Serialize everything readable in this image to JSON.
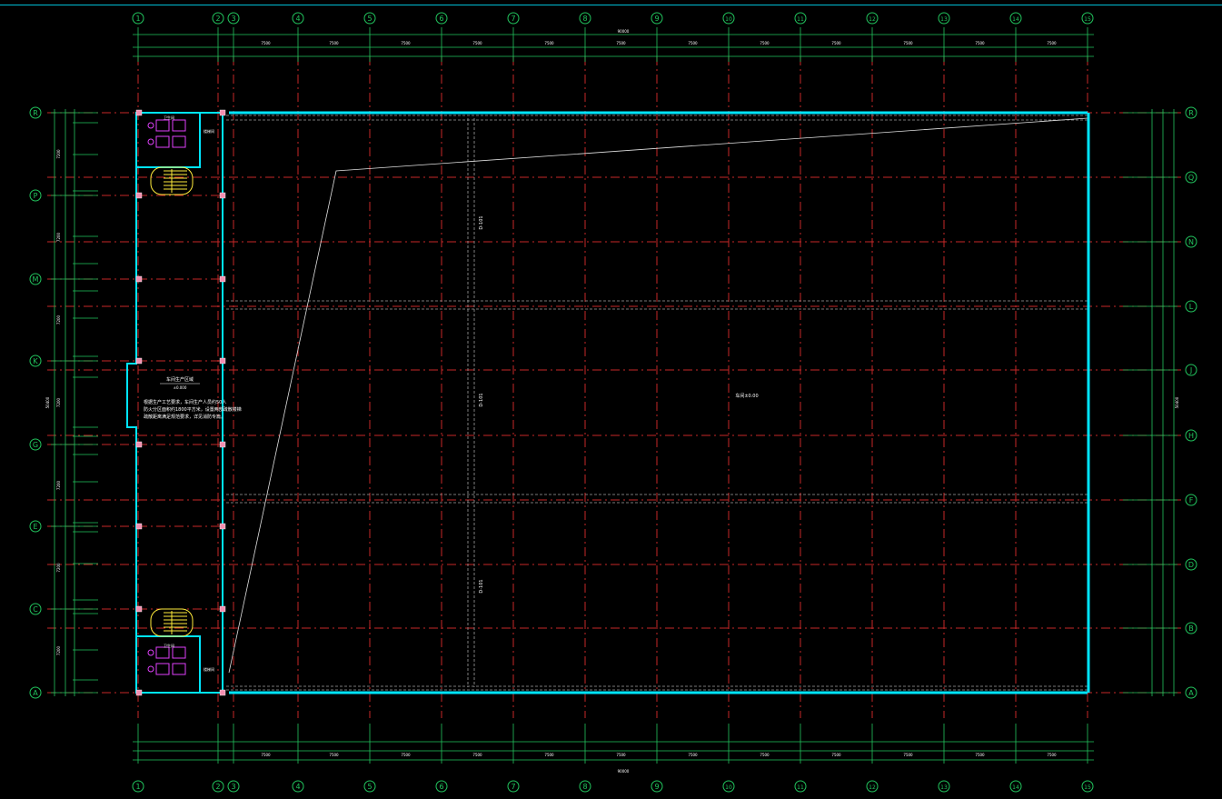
{
  "drawing": {
    "colors": {
      "background": "#000000",
      "grid_lines": "#c62828",
      "dimensions": "#22c55e",
      "axis_bubbles": "#22c55e",
      "walls": "#00e5ff",
      "stairs": "#ffeb3b",
      "fixtures": "#e040fb",
      "columns": "#f48fb1",
      "annotations": "#ffffff",
      "dashed_beams": "#9e9e9e"
    },
    "column_axes": [
      "1",
      "2",
      "3",
      "4",
      "5",
      "6",
      "7",
      "8",
      "9",
      "10",
      "11",
      "12",
      "13",
      "14",
      "15"
    ],
    "row_axes_left": [
      "R",
      "P",
      "M",
      "K",
      "G",
      "E",
      "C",
      "A"
    ],
    "row_axes_right": [
      "R",
      "Q",
      "N",
      "L",
      "J",
      "H",
      "F",
      "D",
      "B",
      "A"
    ],
    "top_total_dimension": "90000",
    "bottom_total_dimension": "90000",
    "column_spacing_labels": [
      "7500",
      "7500",
      "7500",
      "7500",
      "7500",
      "7500",
      "7500",
      "7500",
      "7500",
      "7500",
      "7500",
      "7500"
    ],
    "center_label": "车间±0.00",
    "beam_label_1": "D-101",
    "beam_label_2": "D-101",
    "beam_label_3": "D-101",
    "note_title": "车间生产区域",
    "note_sub": "±0.000",
    "note_lines": [
      "根据生产工艺要求，车间生产人员约50人",
      "防火分区面积约1800平方米，设置两部疏散楼梯",
      "疏散距离满足规范要求，详见消防专篇。"
    ],
    "room_labels": {
      "top_toilet": "卫生间",
      "top_stair": "楼梯间",
      "bottom_toilet": "卫生间",
      "bottom_stair": "楼梯间"
    },
    "side_dims": [
      "7200",
      "7200",
      "7200",
      "7200",
      "7200",
      "7200",
      "7200"
    ],
    "left_total": "50400",
    "right_total": "50400"
  }
}
